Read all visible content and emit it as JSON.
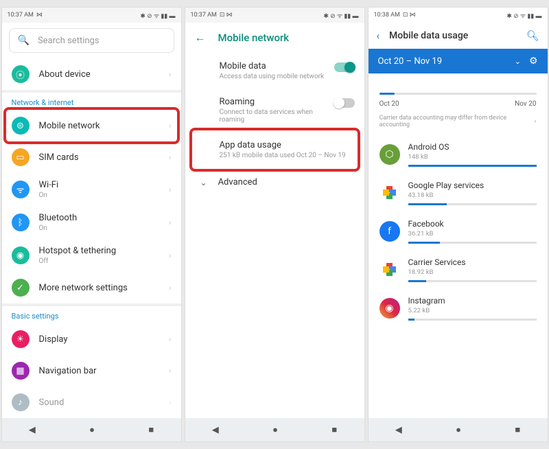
{
  "status": {
    "time1": "10:37 AM",
    "time2": "10:37 AM",
    "time3": "10:38 AM",
    "icons": "⁂ ⊘ ᯤ ▮▮▯ ▬"
  },
  "p1": {
    "search_ph": "Search settings",
    "about": "About device",
    "section_net": "Network & internet",
    "items": [
      {
        "label": "Mobile network"
      },
      {
        "label": "SIM cards"
      },
      {
        "label": "Wi-Fi",
        "sub": "On"
      },
      {
        "label": "Bluetooth",
        "sub": "On"
      },
      {
        "label": "Hotspot & tethering",
        "sub": "Off"
      },
      {
        "label": "More network settings"
      }
    ],
    "section_basic": "Basic settings",
    "basic": [
      {
        "label": "Display"
      },
      {
        "label": "Navigation bar"
      },
      {
        "label": "Sound"
      }
    ]
  },
  "p2": {
    "title": "Mobile network",
    "rows": [
      {
        "label": "Mobile data",
        "sub": "Access data using mobile network",
        "on": true
      },
      {
        "label": "Roaming",
        "sub": "Connect to data services when roaming",
        "on": false
      },
      {
        "label": "App data usage",
        "sub": "251 kB mobile data used Oct 20 – Nov 19"
      }
    ],
    "advanced": "Advanced"
  },
  "p3": {
    "title": "Mobile data usage",
    "range": "Oct 20 – Nov 19",
    "tl_start": "Oct 20",
    "tl_end": "Nov 20",
    "note": "Carrier data accounting may differ from device accounting",
    "apps": [
      {
        "name": "Android OS",
        "size": "148 kB",
        "pct": 100
      },
      {
        "name": "Google Play services",
        "size": "43.18 kB",
        "pct": 30
      },
      {
        "name": "Facebook",
        "size": "36.21 kB",
        "pct": 25
      },
      {
        "name": "Carrier Services",
        "size": "18.92 kB",
        "pct": 14
      },
      {
        "name": "Instagram",
        "size": "5.22 kB",
        "pct": 5
      }
    ]
  }
}
